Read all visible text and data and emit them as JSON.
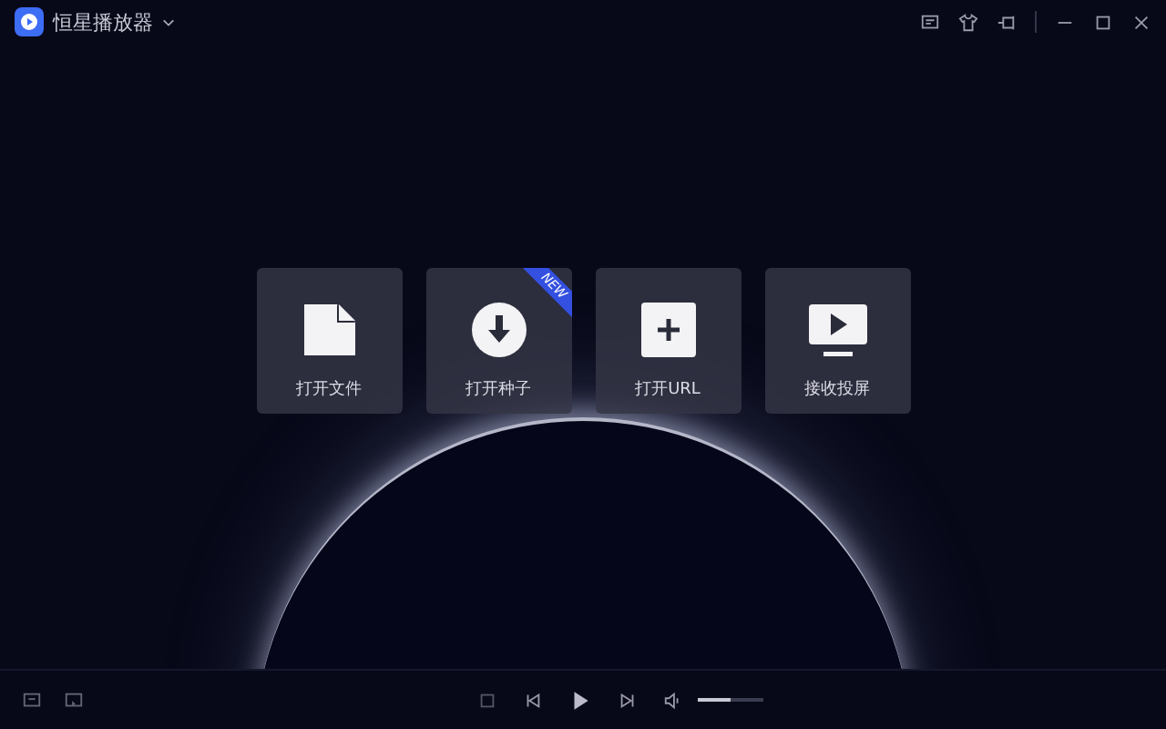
{
  "window": {
    "title": "恒星播放器"
  },
  "actions": [
    {
      "kind": "file",
      "label": "打开文件"
    },
    {
      "kind": "download",
      "label": "打开种子",
      "badge": "NEW"
    },
    {
      "kind": "plus",
      "label": "打开URL"
    },
    {
      "kind": "screen",
      "label": "接收投屏"
    }
  ],
  "player": {
    "volume": {
      "level": 0.5
    }
  }
}
